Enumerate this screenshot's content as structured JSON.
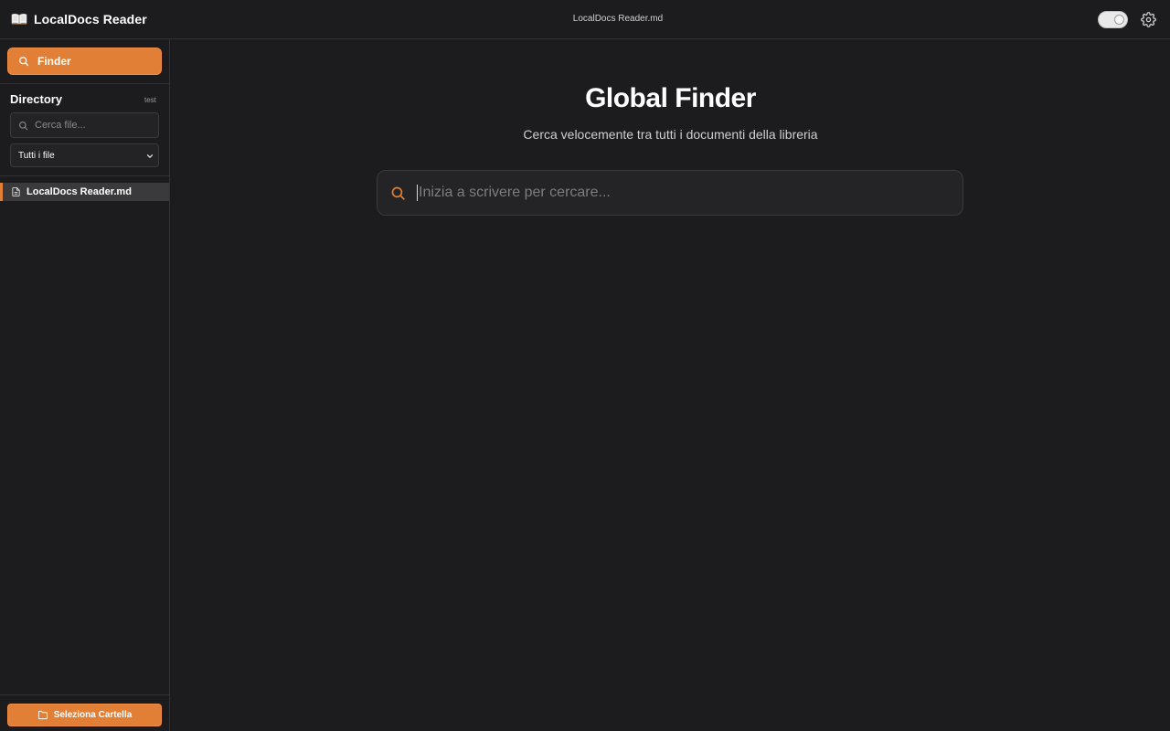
{
  "app": {
    "title": "LocalDocs Reader",
    "document_title": "LocalDocs Reader.md"
  },
  "header": {
    "theme_toggle_icon": "toggle-switch",
    "settings_icon": "gear-icon"
  },
  "sidebar": {
    "finder_label": "Finder",
    "directory_title": "Directory",
    "directory_tag": "test",
    "search_placeholder": "Cerca file...",
    "filter_selected": "Tutti i file",
    "files": [
      {
        "name": "LocalDocs Reader.md",
        "active": true
      }
    ],
    "select_folder_label": "Seleziona Cartella"
  },
  "main": {
    "title": "Global Finder",
    "subtitle": "Cerca velocemente tra tutti i documenti della libreria",
    "search_placeholder": "Inizia a scrivere per cercare...",
    "search_value": ""
  },
  "colors": {
    "accent": "#e07f35",
    "background": "#1c1c1e",
    "panel": "#242426",
    "border": "#323234"
  }
}
